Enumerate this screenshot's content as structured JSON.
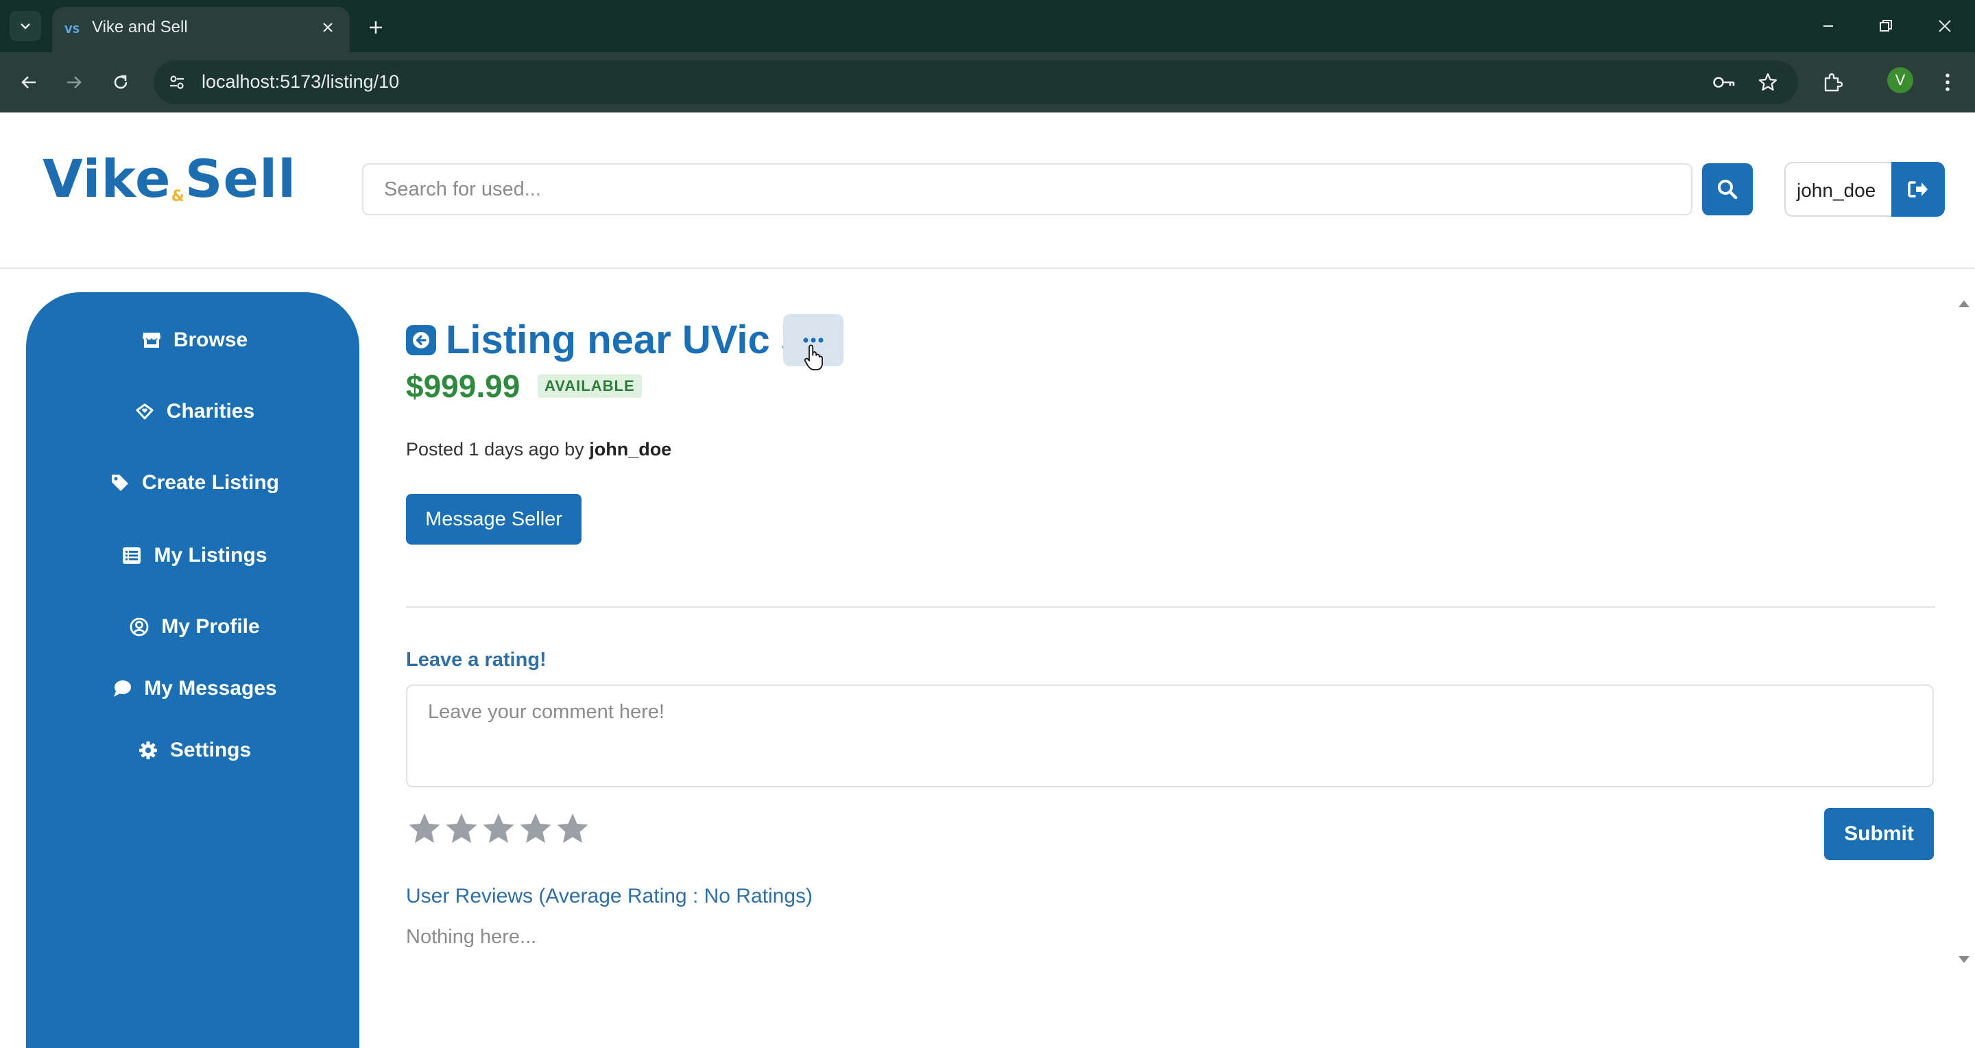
{
  "browser": {
    "tab_title": "Vike and Sell",
    "tab_favicon": "VS",
    "url": "localhost:5173/listing/10",
    "profile_initial": "V"
  },
  "header": {
    "logo_left": "Vike",
    "logo_amp": "&",
    "logo_right": "Sell",
    "search_placeholder": "Search for used...",
    "username": "john_doe"
  },
  "sidebar": {
    "items": [
      {
        "label": "Browse",
        "icon": "store-icon"
      },
      {
        "label": "Charities",
        "icon": "hand-heart-icon"
      },
      {
        "label": "Create Listing",
        "icon": "tag-icon"
      },
      {
        "label": "My Listings",
        "icon": "list-icon"
      },
      {
        "label": "My Profile",
        "icon": "user-circle-icon"
      },
      {
        "label": "My Messages",
        "icon": "chat-bubble-icon"
      },
      {
        "label": "Settings",
        "icon": "gear-icon"
      }
    ]
  },
  "listing": {
    "title": "Listing near UVic 5",
    "price": "$999.99",
    "status": "AVAILABLE",
    "posted_prefix": "Posted 1 days ago by",
    "seller": "john_doe",
    "message_button": "Message Seller"
  },
  "rating": {
    "label": "Leave a rating!",
    "comment_placeholder": "Leave your comment here!",
    "stars_selected": 0,
    "stars_total": 5,
    "submit_label": "Submit"
  },
  "reviews": {
    "title": "User Reviews (Average Rating : No Ratings)",
    "empty_text": "Nothing here..."
  },
  "colors": {
    "brand": "#1a6fb5",
    "price": "#2e8a3e",
    "chrome": "#122f2a"
  }
}
